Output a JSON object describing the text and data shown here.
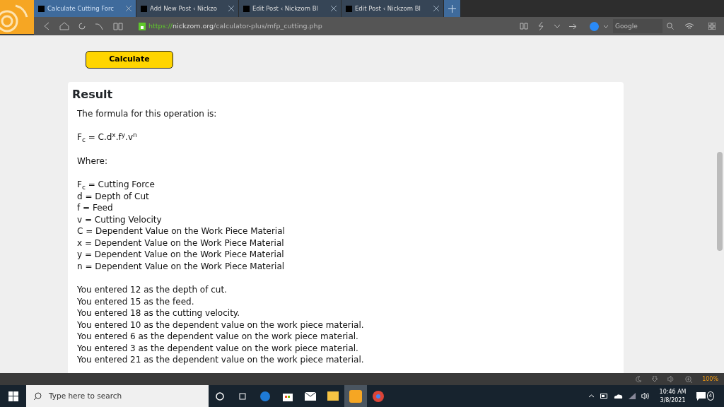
{
  "browser": {
    "tabs": [
      {
        "title": "Calculate Cutting Forc",
        "selected": true
      },
      {
        "title": "Add New Post ‹ Nickzo",
        "selected": false
      },
      {
        "title": "Edit Post ‹ Nickzom Bl",
        "selected": false
      },
      {
        "title": "Edit Post ‹ Nickzom Bl",
        "selected": false
      }
    ],
    "address": {
      "scheme": "https://",
      "host": "nickzom.org",
      "path": "/calculator-plus/mfp_cutting.php"
    },
    "search": {
      "placeholder": "Google"
    }
  },
  "page": {
    "button": "Calculate",
    "result": {
      "title": "Result",
      "blocks": [
        [
          "The formula for this operation is:"
        ],
        [
          "F$_{c}$ = C.d$^{x}$.f$^{y}$.v$^{n}$"
        ],
        [
          "Where:"
        ],
        [
          "F$_{c}$ = Cutting Force",
          "d = Depth of Cut",
          "f = Feed",
          "v = Cutting Velocity",
          "C = Dependent Value on the Work Piece Material",
          "x = Dependent Value on the Work Piece Material",
          "y = Dependent Value on the Work Piece Material",
          "n = Dependent Value on the Work Piece Material"
        ],
        [
          "You entered 12 as the depth of cut.",
          "You entered 15 as the feed.",
          "You entered 18 as the cutting velocity.",
          "You entered 10 as the dependent value on the work piece material.",
          "You entered 6 as the dependent value on the work piece material.",
          "You entered 3 as the dependent value on the work piece material.",
          "You entered 21 as the dependent value on the work piece material."
        ]
      ]
    }
  },
  "status_bar": {
    "zoom": "100%"
  },
  "taskbar": {
    "search": {
      "placeholder": "Type here to search"
    },
    "time": "10:46 AM",
    "date": "3/8/2021",
    "notifications": "4"
  }
}
